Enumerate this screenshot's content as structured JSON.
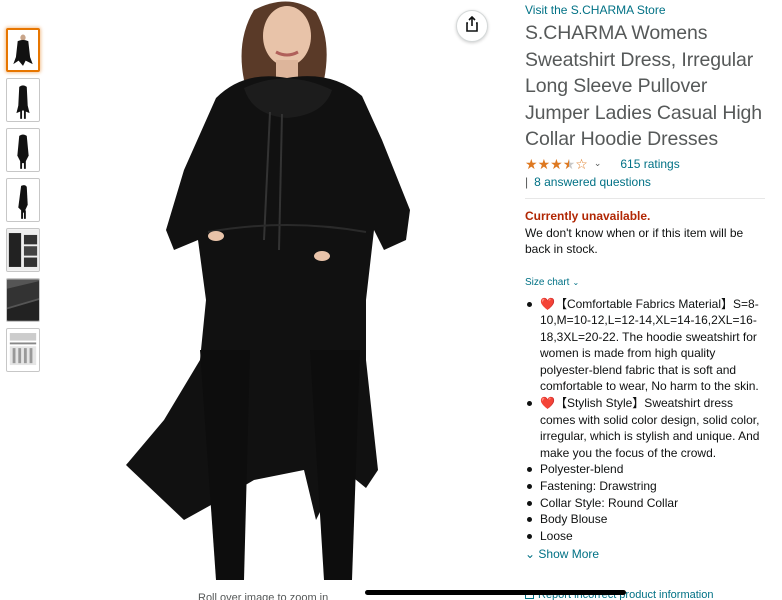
{
  "product": {
    "store_link": "Visit the S.CHARMA Store",
    "title": "S.CHARMA Womens Sweatshirt Dress, Irregular Long Sleeve Pullover Jumper Ladies Casual High Collar Hoodie Dresses",
    "rating": 3.5,
    "ratings_count": "615 ratings",
    "answered_questions": "8 answered questions",
    "availability": "Currently unavailable.",
    "availability_message": "We don't know when or if this item will be back in stock.",
    "size_chart": "Size chart",
    "bullets": [
      {
        "heart": true,
        "text": "【Comfortable Fabrics Material】S=8-10,M=10-12,L=12-14,XL=14-16,2XL=16-18,3XL=20-22. The hoodie sweatshirt for women is made from high quality polyester-blend fabric that is soft and comfortable to wear, No harm to the skin."
      },
      {
        "heart": true,
        "text": "【Stylish Style】Sweatshirt dress comes with solid color design, solid color, irregular, which is stylish and unique. And make you the focus of the crowd."
      },
      {
        "heart": false,
        "text": "Polyester-blend"
      },
      {
        "heart": false,
        "text": "Fastening: Drawstring"
      },
      {
        "heart": false,
        "text": "Collar Style: Round Collar"
      },
      {
        "heart": false,
        "text": "Body Blouse"
      },
      {
        "heart": false,
        "text": "Loose"
      }
    ],
    "show_more": "Show More",
    "report_link": "Report incorrect product information",
    "zoom_hint": "Roll over image to zoom in"
  },
  "gallery": {
    "thumbnail_count": 7,
    "active_index": 0
  },
  "colors": {
    "link": "#007185",
    "star": "#de7921",
    "unavailable": "#b12704",
    "active_thumb": "#e77600"
  },
  "icons": {
    "share": "share-icon",
    "heart": "heart-icon",
    "chevron": "chevron-down-icon"
  }
}
